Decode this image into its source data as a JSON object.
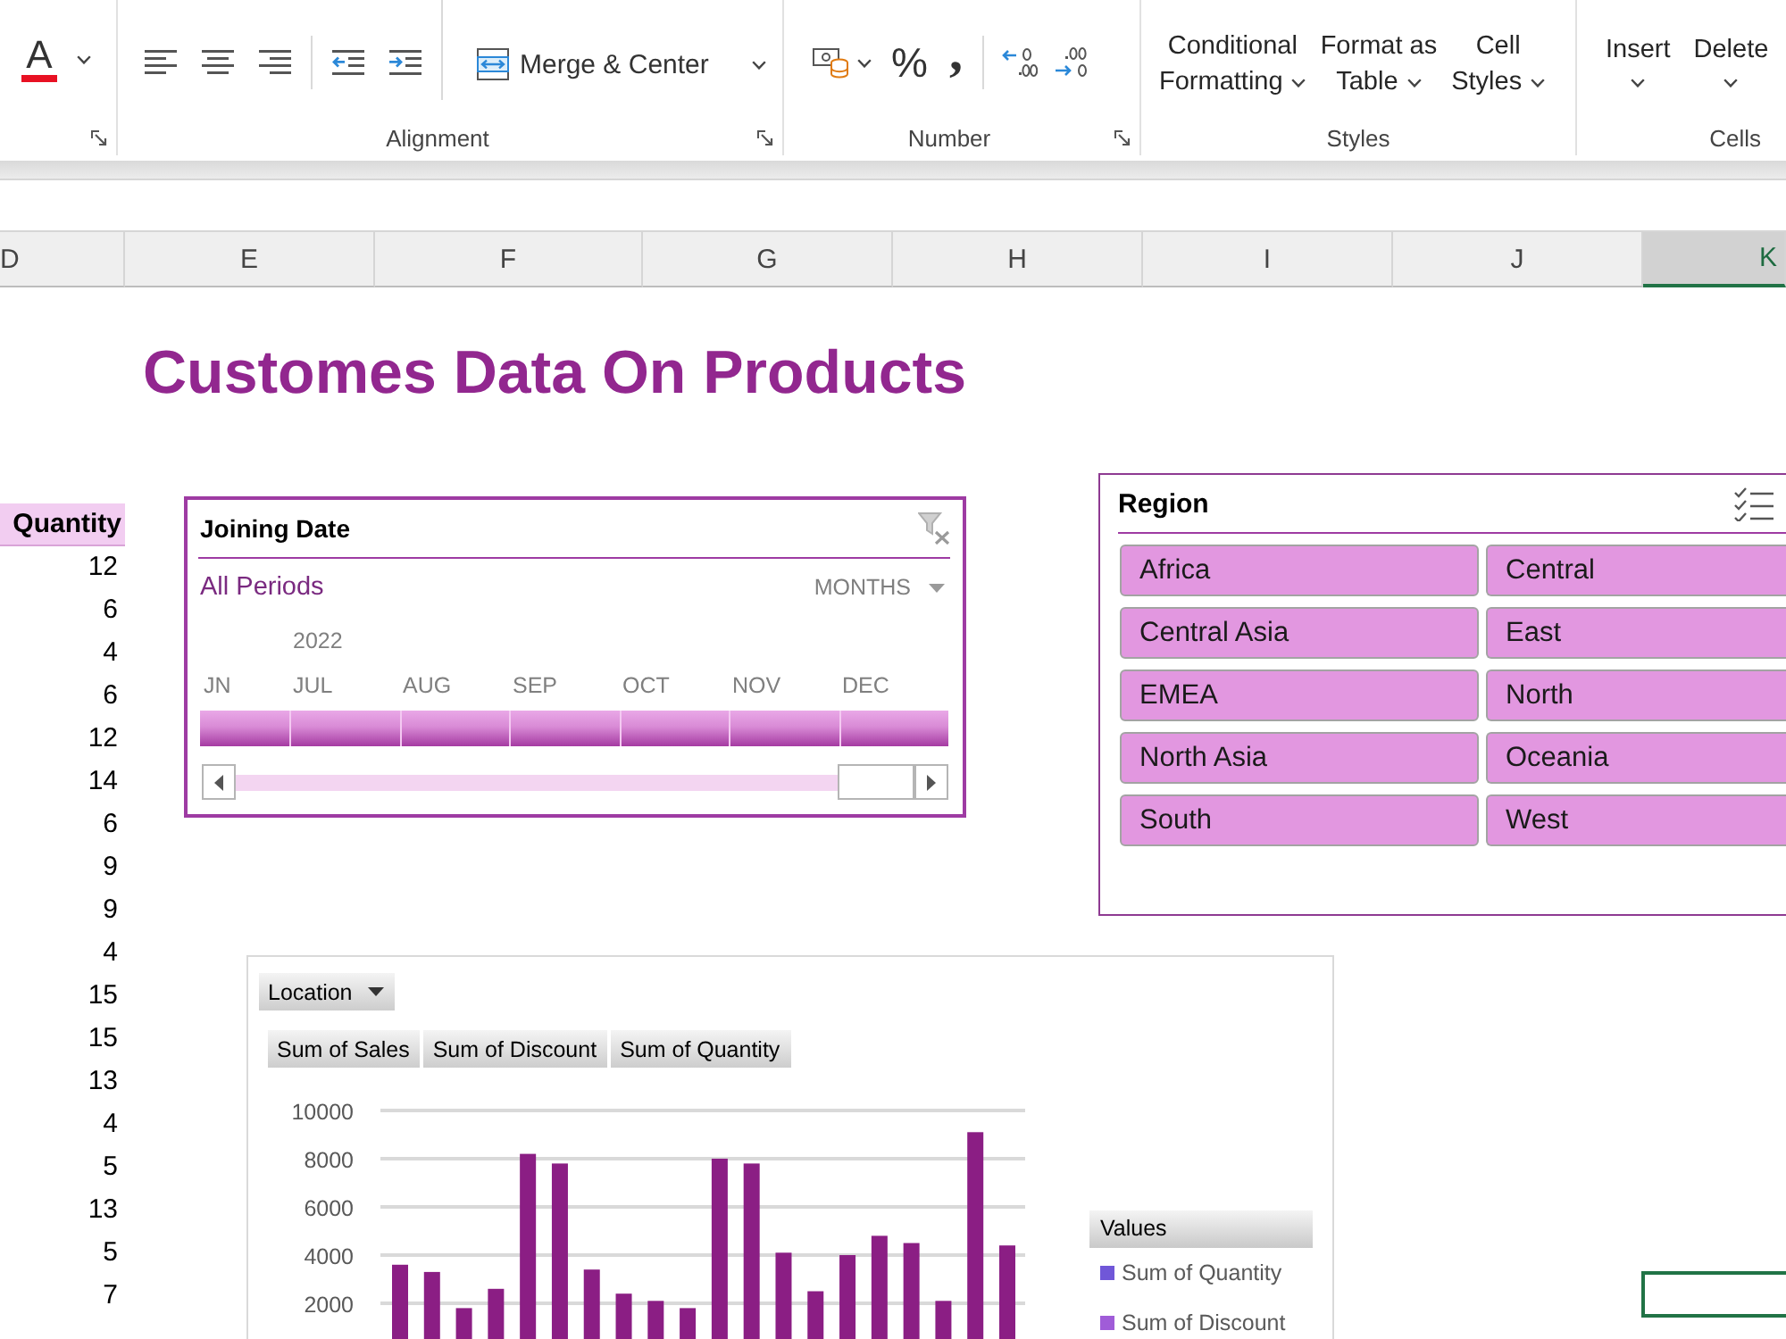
{
  "ribbon": {
    "font": {
      "color_button": "A"
    },
    "alignment": {
      "label": "Alignment",
      "merge_button": "Merge & Center"
    },
    "number": {
      "label": "Number",
      "symbol_buttons": [
        "%",
        ","
      ]
    },
    "styles": {
      "label": "Styles",
      "buttons": [
        "Conditional Formatting",
        "Format as Table",
        "Cell Styles"
      ]
    },
    "cells": {
      "label": "Cells",
      "buttons": [
        "Insert",
        "Delete"
      ]
    }
  },
  "column_headers": [
    {
      "label": "D",
      "selected": false
    },
    {
      "label": "E",
      "selected": false
    },
    {
      "label": "F",
      "selected": false
    },
    {
      "label": "G",
      "selected": false
    },
    {
      "label": "H",
      "selected": false
    },
    {
      "label": "I",
      "selected": false
    },
    {
      "label": "J",
      "selected": false
    },
    {
      "label": "K",
      "selected": true
    }
  ],
  "title": "Customes Data On Products",
  "quantity_column": {
    "header": "Quantity",
    "values": [
      "12",
      "6",
      "4",
      "6",
      "12",
      "14",
      "6",
      "9",
      "9",
      "4",
      "15",
      "15",
      "13",
      "4",
      "5",
      "13",
      "5",
      "7"
    ]
  },
  "timeline": {
    "title": "Joining Date",
    "period": "All Periods",
    "time_level": "MONTHS",
    "year": "2022",
    "months": [
      {
        "label": "JN",
        "selected": true
      },
      {
        "label": "JUL",
        "selected": true
      },
      {
        "label": "AUG",
        "selected": true
      },
      {
        "label": "SEP",
        "selected": true
      },
      {
        "label": "OCT",
        "selected": true
      },
      {
        "label": "NOV",
        "selected": true
      },
      {
        "label": "DEC",
        "selected": true
      }
    ]
  },
  "region_slicer": {
    "title": "Region",
    "items": [
      {
        "label": "Africa",
        "selected": true
      },
      {
        "label": "Central",
        "selected": true
      },
      {
        "label": "Central Asia",
        "selected": true
      },
      {
        "label": "East",
        "selected": true
      },
      {
        "label": "EMEA",
        "selected": true
      },
      {
        "label": "North",
        "selected": true
      },
      {
        "label": "North Asia",
        "selected": true
      },
      {
        "label": "Oceania",
        "selected": true
      },
      {
        "label": "South",
        "selected": true
      },
      {
        "label": "West",
        "selected": true
      }
    ]
  },
  "chart": {
    "filter_button": "Location",
    "value_buttons": [
      "Sum of Sales",
      "Sum of Discount",
      "Sum of Quantity"
    ],
    "chart_data": {
      "type": "bar",
      "grid": true,
      "ylim": [
        0,
        10000
      ],
      "yticks": [
        2000,
        4000,
        6000,
        8000,
        10000
      ],
      "series": [
        {
          "color": "#8b1e84",
          "values": [
            3600,
            3300,
            1800,
            2600,
            8200,
            7800,
            3400,
            2400,
            2100,
            1800,
            8000,
            7800,
            4100,
            2500,
            4000,
            4800,
            4500,
            2100,
            9100,
            4400
          ]
        }
      ]
    },
    "legend": {
      "title": "Values",
      "items": [
        {
          "label": "Sum of Quantity",
          "color": "#7057d8"
        },
        {
          "label": "Sum of Discount",
          "color": "#a05cd8"
        }
      ]
    }
  }
}
